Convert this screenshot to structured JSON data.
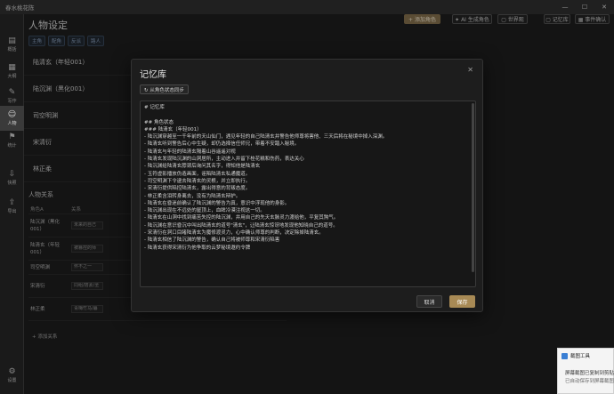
{
  "app": {
    "title": "春水桃花陈"
  },
  "window_controls": {
    "minimize": "—",
    "maximize": "☐",
    "close": "✕"
  },
  "sidebar": {
    "items": [
      {
        "icon": "▤",
        "label": "概括"
      },
      {
        "icon": "▦",
        "label": "大纲"
      },
      {
        "icon": "✎",
        "label": "写作"
      },
      {
        "icon": "☺",
        "label": "人物"
      },
      {
        "icon": "⚑",
        "label": "统计"
      },
      {
        "icon": "⇩",
        "label": "快照"
      },
      {
        "icon": "⇪",
        "label": "导出"
      }
    ],
    "settings": {
      "icon": "⚙",
      "label": "设置"
    }
  },
  "page": {
    "title": "人物设定",
    "tags": [
      "主角",
      "配角",
      "反派",
      "路人"
    ],
    "toolbar": {
      "add_character": "+ 添加角色",
      "ai_generate": "✦ AI 生成角色",
      "worldview": "▢ 世界观",
      "memory_bank": "▢ 记忆库",
      "event_log": "▦ 事件确认"
    },
    "characters": [
      "陆清玄（年轻001）",
      "陆沉渊（黑化001）",
      "司空明渊",
      "宋清衍",
      "林正柔"
    ]
  },
  "relations": {
    "title": "人物关系",
    "headers": [
      "角色A",
      "关系"
    ],
    "rows": [
      {
        "a": "陆沉渊（黑化001）",
        "rel": "未来的自己"
      },
      {
        "a": "陆清玄（年轻001）",
        "rel": "被篡控的师"
      },
      {
        "a": "司空明渊",
        "rel": "怀不之一"
      },
      {
        "a": "宋清衍",
        "rel": "同组/搭素/圣"
      },
      {
        "a": "林正柔",
        "rel": "青梅竹马/暮"
      }
    ],
    "add_label": "+ 添加关系"
  },
  "modal": {
    "title": "记忆库",
    "close": "✕",
    "sync_label": "↻ 从角色状态同步",
    "content_lines": [
      "# 记忆库",
      "",
      "## 角色状态",
      "### 陆清玄（年轻001）",
      "- 陆沉渊穿越至一千年前的天山仙门，遇见年轻的自己陆清玄并警告他师尊将害他、三天后将在秘境中掉入深渊。",
      "- 陆清玄听到警告后心中生疑，却仍选择信任师兄，带着不安踏入秘境。",
      "- 陆清玄与年轻的陆清玄隔着山谷遥遥对视",
      "- 陆清玄发现陆沉渊的山洞居所，主动进入并留下桂花糕和伤药，表达关心",
      "- 陆沉渊给陆清玄脖颈后询问其名字，得知他是陆清玄",
      "- 玉符虚影播放伪造画面，诬陷陆清玄私通魔道。",
      "- 司空明渊下令逮去陆清玄的灵根，并立即执行。",
      "- 宋清衍提供陷控陆清玄，露出得意的背叛态度。",
      "- 林正柔含泪转身离去，没有为陆清玄辩护。",
      "- 陆清玄在昏迷前确认了陆沉渊的警告为真，意识中浮现他的身影。",
      "- 陆沉渊出现在不远处的屋顶上，血眸冷漠注视这一切。",
      "- 陆清玄在山洞中找到痛苦失控的陆沉渊，并用自己的先天玄脉灵力渡给他，平复其煞气。",
      "- 陆沉渊在意识昏沉中叫出陆清玄的道号\"清玄\"，让陆清玄惊讶地发现他知晓自己的道号。",
      "- 宋清衍在洞口目睹陆清玄为魔修渡灵力，心中确认师尊的判断，决定除掉陆清玄。",
      "- 陆清玄相信了陆沉渊的警告，确认自己将被师尊和宋清衍陷害",
      "- 陆清玄获得宋清衍为他争取的云梦秘境邀约令牌"
    ],
    "cancel_label": "取消",
    "save_label": "保存"
  },
  "toast": {
    "title": "截图工具",
    "message": "屏幕截图已复制到剪贴板",
    "sub": "已自动保存到屏幕截图"
  }
}
